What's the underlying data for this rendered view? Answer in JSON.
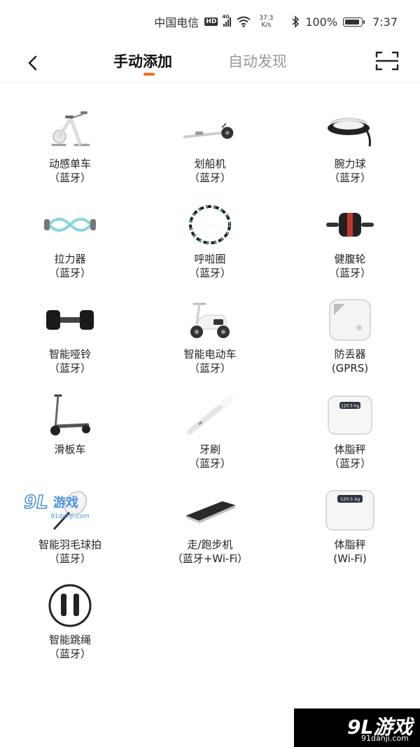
{
  "status_bar": {
    "carrier": "中国电信",
    "hd": "HD",
    "network": "4G",
    "speed_value": "37.3",
    "speed_unit": "K/s",
    "battery": "100%",
    "time": "7:37"
  },
  "nav": {
    "tabs": [
      {
        "label": "手动添加",
        "active": true
      },
      {
        "label": "自动发现",
        "active": false
      }
    ],
    "accent_color": "#ff6a1a"
  },
  "devices": [
    {
      "name": "动感单车",
      "conn": "（蓝牙）",
      "icon": "spin-bike-icon"
    },
    {
      "name": "划船机",
      "conn": "（蓝牙）",
      "icon": "rowing-machine-icon"
    },
    {
      "name": "腕力球",
      "conn": "（蓝牙）",
      "icon": "wrist-ball-icon"
    },
    {
      "name": "拉力器",
      "conn": "（蓝牙）",
      "icon": "resistance-band-icon"
    },
    {
      "name": "呼啦圈",
      "conn": "（蓝牙）",
      "icon": "hula-hoop-icon"
    },
    {
      "name": "健腹轮",
      "conn": "（蓝牙）",
      "icon": "ab-wheel-icon"
    },
    {
      "name": "智能哑铃",
      "conn": "（蓝牙）",
      "icon": "dumbbell-icon"
    },
    {
      "name": "智能电动车",
      "conn": "（蓝牙）",
      "icon": "e-scooter-icon"
    },
    {
      "name": "防丢器",
      "conn": "(GPRS)",
      "icon": "tracker-tag-icon"
    },
    {
      "name": "滑板车",
      "conn": "",
      "icon": "kick-scooter-icon"
    },
    {
      "name": "牙刷",
      "conn": "（蓝牙）",
      "icon": "toothbrush-icon"
    },
    {
      "name": "体脂秤",
      "conn": "（蓝牙）",
      "icon": "body-fat-scale-icon",
      "display": "120.5 kg"
    },
    {
      "name": "智能羽毛球拍",
      "conn": "（蓝牙）",
      "icon": "badminton-racket-icon"
    },
    {
      "name": "走/跑步机",
      "conn": "（蓝牙+Wi-Fi）",
      "icon": "treadmill-icon"
    },
    {
      "name": "体脂秤",
      "conn": "(Wi-Fi)",
      "icon": "body-fat-scale-icon",
      "display": "120.5 kg"
    },
    {
      "name": "智能跳绳",
      "conn": "（蓝牙）",
      "icon": "jump-rope-icon"
    }
  ],
  "watermark": {
    "logo": "9L游戏",
    "url": "91danji.com"
  }
}
